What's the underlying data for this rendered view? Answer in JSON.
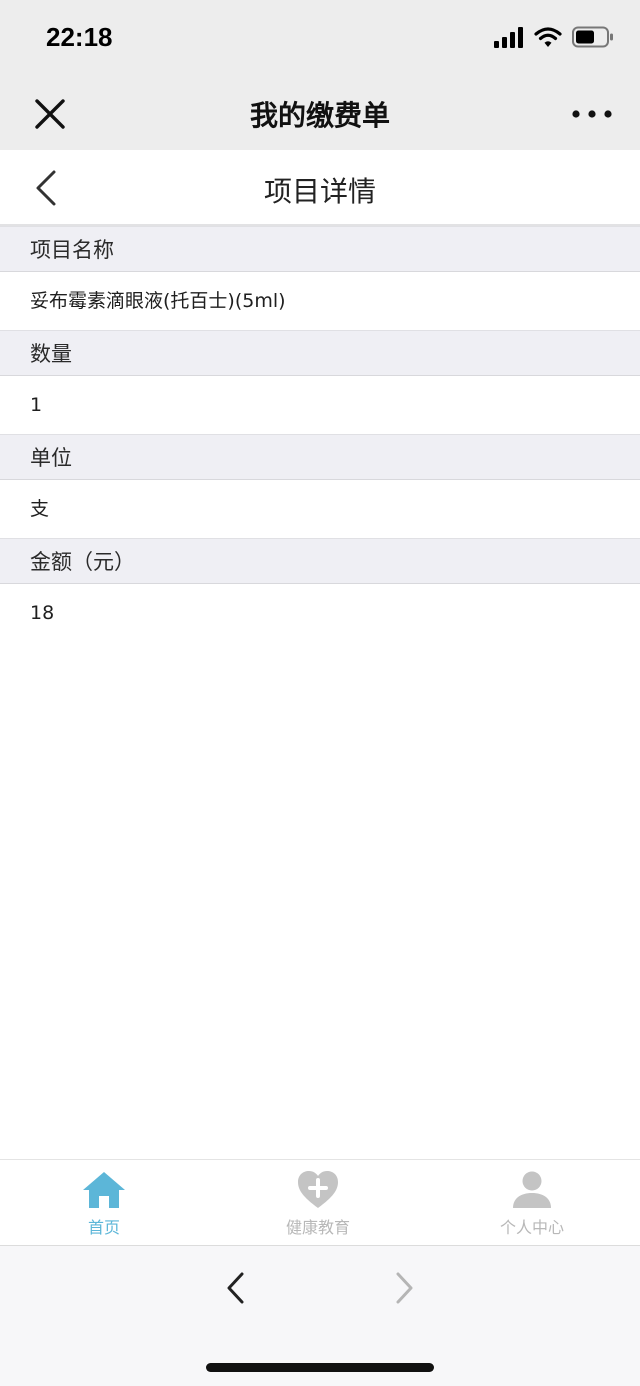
{
  "status_bar": {
    "time": "22:18",
    "icons": [
      "signal-icon",
      "wifi-icon",
      "battery-icon"
    ]
  },
  "wechat_bar": {
    "title": "我的缴费单",
    "close_icon": "close-icon",
    "more_icon": "more-icon"
  },
  "header": {
    "title": "项目详情",
    "back_icon": "chevron-left-icon"
  },
  "fields": [
    {
      "label": "项目名称",
      "value": "妥布霉素滴眼液(托百士)(5ml)"
    },
    {
      "label": "数量",
      "value": "1"
    },
    {
      "label": "单位",
      "value": "支"
    },
    {
      "label": "金额（元）",
      "value": "18"
    }
  ],
  "tabs": [
    {
      "label": "首页",
      "icon": "home-icon",
      "active": true
    },
    {
      "label": "健康教育",
      "icon": "heart-plus-icon",
      "active": false
    },
    {
      "label": "个人中心",
      "icon": "user-icon",
      "active": false
    }
  ],
  "colors": {
    "accent": "#5cb6d8",
    "inactive": "#c4c4c4",
    "bar_bg": "#ededed",
    "label_bg": "#efeff4"
  }
}
